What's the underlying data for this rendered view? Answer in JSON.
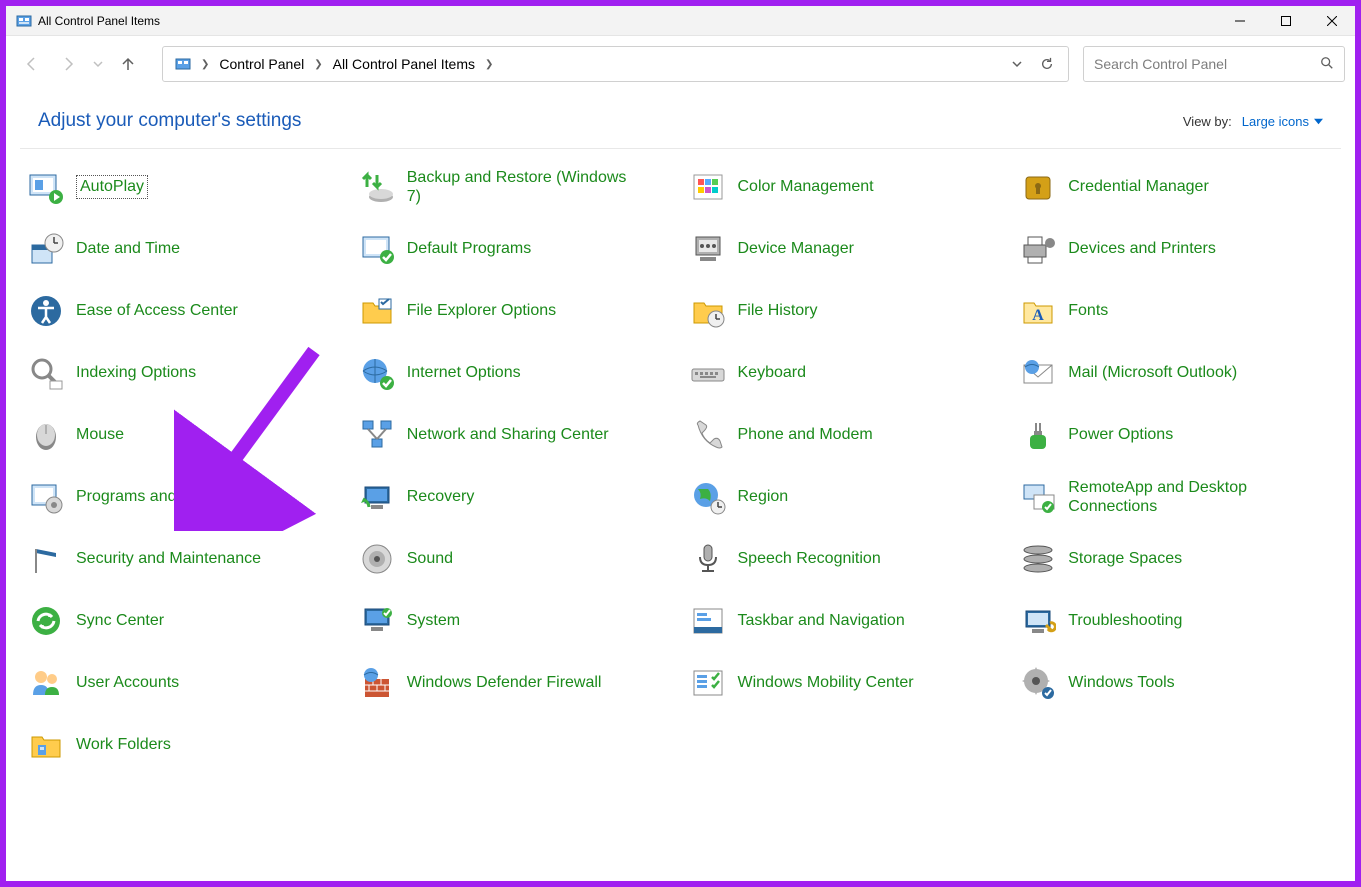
{
  "window": {
    "title": "All Control Panel Items"
  },
  "breadcrumb": {
    "seg1": "Control Panel",
    "seg2": "All Control Panel Items"
  },
  "search": {
    "placeholder": "Search Control Panel"
  },
  "header": {
    "adjust": "Adjust your computer's settings",
    "viewByLabel": "View by:",
    "viewByValue": "Large icons"
  },
  "items": {
    "i0": "AutoPlay",
    "i1": "Backup and Restore (Windows 7)",
    "i2": "Color Management",
    "i3": "Credential Manager",
    "i4": "Date and Time",
    "i5": "Default Programs",
    "i6": "Device Manager",
    "i7": "Devices and Printers",
    "i8": "Ease of Access Center",
    "i9": "File Explorer Options",
    "i10": "File History",
    "i11": "Fonts",
    "i12": "Indexing Options",
    "i13": "Internet Options",
    "i14": "Keyboard",
    "i15": "Mail (Microsoft Outlook)",
    "i16": "Mouse",
    "i17": "Network and Sharing Center",
    "i18": "Phone and Modem",
    "i19": "Power Options",
    "i20": "Programs and Features",
    "i21": "Recovery",
    "i22": "Region",
    "i23": "RemoteApp and Desktop Connections",
    "i24": "Security and Maintenance",
    "i25": "Sound",
    "i26": "Speech Recognition",
    "i27": "Storage Spaces",
    "i28": "Sync Center",
    "i29": "System",
    "i30": "Taskbar and Navigation",
    "i31": "Troubleshooting",
    "i32": "User Accounts",
    "i33": "Windows Defender Firewall",
    "i34": "Windows Mobility Center",
    "i35": "Windows Tools",
    "i36": "Work Folders"
  },
  "colors": {
    "link": "#1b8a1b",
    "accent": "#a020f0",
    "headerLink": "#1a5bb8",
    "viewLink": "#0066cc"
  }
}
